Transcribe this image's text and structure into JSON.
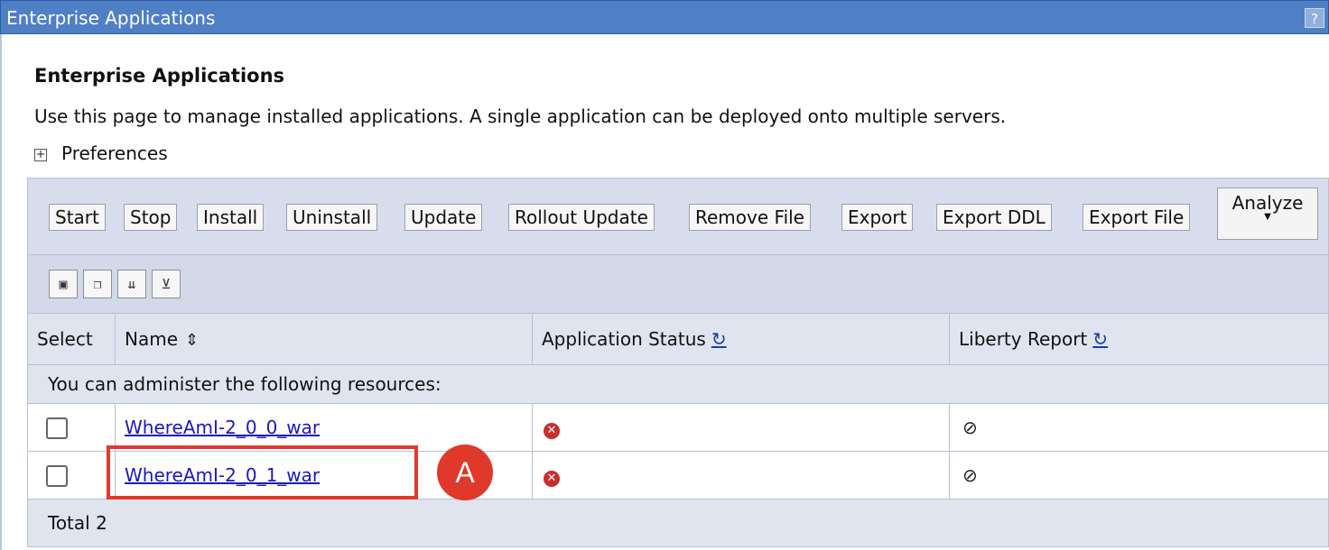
{
  "window": {
    "title": "Enterprise Applications",
    "help_label": "?"
  },
  "page": {
    "heading": "Enterprise Applications",
    "description": "Use this page to manage installed applications. A single application can be deployed onto multiple servers.",
    "preferences_label": "Preferences",
    "preferences_toggle": "+"
  },
  "toolbar": {
    "buttons": [
      "Start",
      "Stop",
      "Install",
      "Uninstall",
      "Update",
      "Rollout Update",
      "Remove File",
      "Export",
      "Export DDL",
      "Export File"
    ],
    "analyze_label": "Analyze",
    "icon_buttons": [
      "select-all-icon",
      "deselect-all-icon",
      "expand-filter-icon",
      "filter-icon"
    ]
  },
  "table": {
    "columns": [
      "Select",
      "Name",
      "Application Status",
      "Liberty Report"
    ],
    "info_text": "You can administer the following resources:",
    "rows": [
      {
        "name": "WhereAmI-2_0_0_war",
        "status_icon": "stopped-red-x-icon",
        "report_icon": "not-available-icon"
      },
      {
        "name": "WhereAmI-2_0_1_war",
        "status_icon": "stopped-red-x-icon",
        "report_icon": "not-available-icon"
      }
    ],
    "total_text": "Total 2"
  },
  "annotation": {
    "label": "A",
    "color": "#e0382b"
  }
}
